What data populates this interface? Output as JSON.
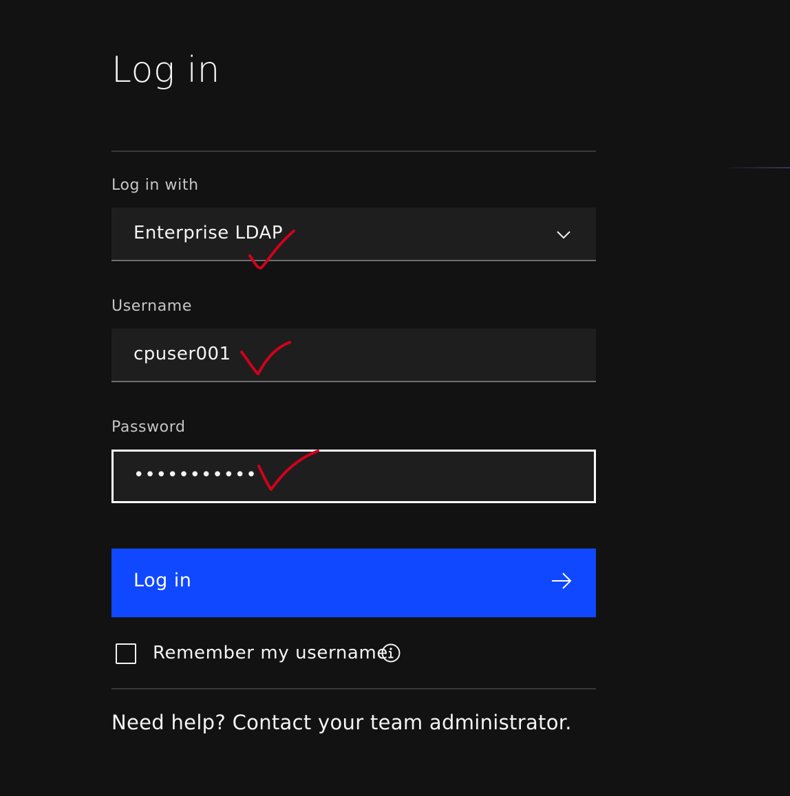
{
  "page": {
    "title": "Log in"
  },
  "login_method": {
    "label": "Log in with",
    "selected": "Enterprise LDAP",
    "options": [
      "Enterprise LDAP"
    ]
  },
  "username": {
    "label": "Username",
    "value": "cpuser001"
  },
  "password": {
    "label": "Password",
    "masked_value": "•••••••••••"
  },
  "login_button": {
    "label": "Log in",
    "icon": "arrow-right-icon"
  },
  "remember": {
    "label": "Remember my username",
    "checked": false,
    "icon": "info-icon"
  },
  "help": {
    "text": "Need help? Contact your team administrator."
  },
  "annotations": {
    "checkmark_color": "#d0021b",
    "count": 3
  },
  "colors": {
    "background": "#121212",
    "field_background": "#1e1e1e",
    "primary_button": "#0f48ff",
    "text": "#f4f4f4",
    "label": "#c6c6c6"
  }
}
